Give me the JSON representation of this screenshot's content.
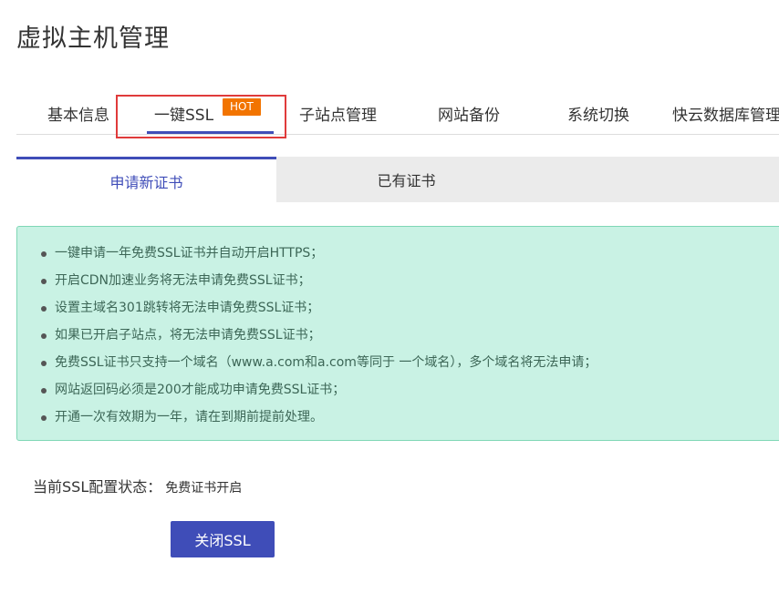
{
  "page_title": "虚拟主机管理",
  "nav": {
    "items": [
      {
        "label": "基本信息"
      },
      {
        "label": "一键SSL"
      },
      {
        "label": "子站点管理"
      },
      {
        "label": "网站备份"
      },
      {
        "label": "系统切换"
      },
      {
        "label": "快云数据库管理"
      }
    ],
    "active_index": 1,
    "hot_badge": "HOT"
  },
  "subtabs": {
    "items": [
      {
        "label": "申请新证书"
      },
      {
        "label": "已有证书"
      }
    ],
    "active_index": 0
  },
  "info": {
    "items": [
      "一键申请一年免费SSL证书并自动开启HTTPS；",
      "开启CDN加速业务将无法申请免费SSL证书；",
      "设置主域名301跳转将无法申请免费SSL证书；",
      "如果已开启子站点，将无法申请免费SSL证书；",
      "免费SSL证书只支持一个域名（www.a.com和a.com等同于 一个域名），多个域名将无法申请；",
      "网站返回码必须是200才能成功申请免费SSL证书；",
      "开通一次有效期为一年，请在到期前提前处理。"
    ]
  },
  "status": {
    "label": "当前SSL配置状态：",
    "value": "免费证书开启"
  },
  "actions": {
    "close_ssl_label": "关闭SSL"
  },
  "colors": {
    "accent": "#3f4db8",
    "hot_badge": "#f27400",
    "info_bg": "#c9f2e4",
    "highlight": "#e03b3b"
  }
}
